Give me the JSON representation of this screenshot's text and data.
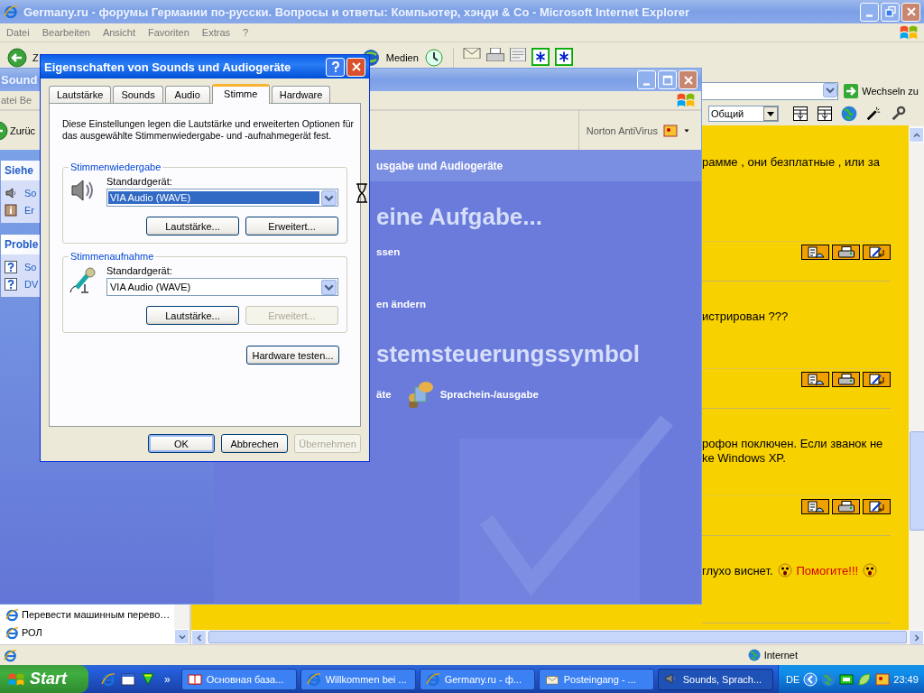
{
  "browser_window": {
    "title": "Germany.ru - форумы Германии по-русски. Вопросы и ответы: Компьютер, хэнди & Co - Microsoft Internet Explorer",
    "menu": [
      "Datei",
      "Bearbeiten",
      "Ansicht",
      "Favoriten",
      "Extras",
      "?"
    ],
    "back_label": "Z",
    "media_label": "Medien",
    "go_label": "Wechseln zu",
    "style_dropdown": "Общий",
    "posts": [
      {
        "lines": [
          [
            {
              "kind": "text",
              "text": "рамме , они безплатные , или за"
            }
          ]
        ],
        "actions": [
          {
            "kind": "quote"
          },
          {
            "kind": "print"
          },
          {
            "kind": "edit"
          }
        ]
      },
      {
        "lines": [
          [
            {
              "kind": "text",
              "text": "истрирован ???"
            }
          ]
        ],
        "actions": [
          {
            "kind": "quote"
          },
          {
            "kind": "print"
          },
          {
            "kind": "edit"
          }
        ]
      },
      {
        "lines": [
          [
            {
              "kind": "text",
              "text": "рофон поключен. Если званок не"
            }
          ],
          [
            {
              "kind": "text",
              "text": "ke Windows XP."
            }
          ]
        ],
        "actions": [
          {
            "kind": "quote"
          },
          {
            "kind": "print"
          },
          {
            "kind": "edit"
          }
        ]
      },
      {
        "lines": [
          [
            {
              "kind": "text",
              "text": "глухо виснет."
            },
            {
              "kind": "smiley"
            },
            {
              "kind": "alert",
              "text": "Помогите!!!"
            },
            {
              "kind": "smiley"
            }
          ]
        ]
      }
    ],
    "sidebar_items": [
      "Перевести машинным перево…",
      "РОЛ"
    ],
    "status_zone": "Internet"
  },
  "control_panel_window": {
    "title": "Sound",
    "menu": [
      "atei",
      "Be"
    ],
    "back_label": "Zurüc",
    "norton_label": "Norton AntiVirus",
    "task_pane": [
      {
        "title": "Siehe",
        "items": [
          {
            "kind": "sound",
            "label": "So"
          },
          {
            "kind": "info",
            "label": "Er"
          }
        ]
      },
      {
        "title": "Proble",
        "items": [
          {
            "kind": "help",
            "label": "So"
          },
          {
            "kind": "help",
            "label": "DV"
          }
        ]
      }
    ],
    "header": "usgabe und Audiogeräte",
    "task_heading": "eine Aufgabe...",
    "tasks": [
      "ssen",
      "en ändern"
    ],
    "icon_heading": "stemsteuerungssymbol",
    "icons": [
      {
        "kind": "partial",
        "label": "äte"
      },
      {
        "kind": "speech",
        "label": "Sprachein-/ausgabe"
      }
    ]
  },
  "dialog": {
    "title": "Eigenschaften von Sounds und Audiogeräte",
    "tabs": [
      {
        "label": "Lautstärke",
        "selected": false
      },
      {
        "label": "Sounds",
        "selected": false
      },
      {
        "label": "Audio",
        "selected": false
      },
      {
        "label": "Stimme",
        "selected": true
      },
      {
        "label": "Hardware",
        "selected": false
      }
    ],
    "description": "Diese Einstellungen legen die Lautstärke und erweiterten Optionen für das ausgewählte Stimmenwiedergabe- und -aufnahmegerät fest.",
    "groups": [
      {
        "kind": "playback",
        "title": "Stimmenwiedergabe",
        "device_label": "Standardgerät:",
        "device": "VIA Audio (WAVE)",
        "device_selected": true,
        "buttons": [
          {
            "label": "Lautstärke...",
            "disabled": false
          },
          {
            "label": "Erweitert...",
            "disabled": false
          }
        ]
      },
      {
        "kind": "recording",
        "title": "Stimmenaufnahme",
        "device_label": "Standardgerät:",
        "device": "VIA Audio (WAVE)",
        "device_selected": false,
        "buttons": [
          {
            "label": "Lautstärke...",
            "disabled": false
          },
          {
            "label": "Erweitert...",
            "disabled": true
          }
        ]
      }
    ],
    "test_button": "Hardware testen...",
    "buttons": [
      {
        "label": "OK",
        "default": true,
        "disabled": false
      },
      {
        "label": "Abbrechen",
        "default": false,
        "disabled": false
      },
      {
        "label": "Übernehmen",
        "default": false,
        "disabled": true
      }
    ]
  },
  "taskbar": {
    "start": "Start",
    "more": "»",
    "tasks": [
      {
        "kind": "book",
        "label": "Основная база...",
        "selected": false
      },
      {
        "kind": "browser",
        "label": "Willkommen bei ...",
        "selected": false
      },
      {
        "kind": "browser",
        "label": "Germany.ru - ф...",
        "selected": false
      },
      {
        "kind": "mail",
        "label": "Posteingang - ...",
        "selected": false
      },
      {
        "kind": "sound",
        "label": "Sounds, Sprach...",
        "selected": true
      }
    ],
    "language": "DE",
    "clock": "23:49"
  }
}
